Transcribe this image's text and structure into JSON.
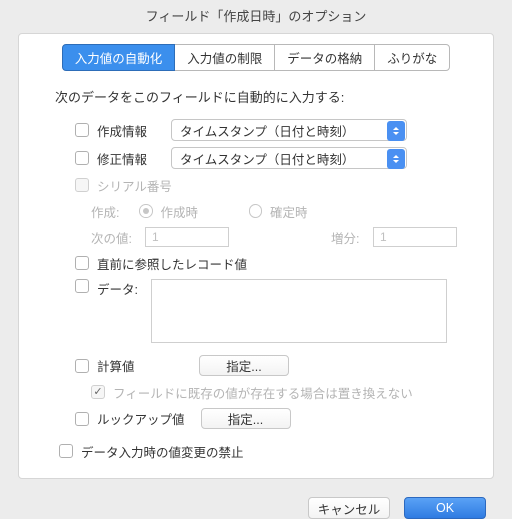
{
  "title": "フィールド「作成日時」のオプション",
  "tabs": [
    "入力値の自動化",
    "入力値の制限",
    "データの格納",
    "ふりがな"
  ],
  "header": "次のデータをこのフィールドに自動的に入力する:",
  "creation": {
    "label": "作成情報",
    "value": "タイムスタンプ（日付と時刻）"
  },
  "modification": {
    "label": "修正情報",
    "value": "タイムスタンプ（日付と時刻）"
  },
  "serial": {
    "label": "シリアル番号",
    "gen_label": "作成:",
    "on_create": "作成時",
    "on_commit": "確定時",
    "next_label": "次の値:",
    "next_value": "1",
    "incr_label": "増分:",
    "incr_value": "1"
  },
  "last_visited": "直前に参照したレコード値",
  "data_label": "データ:",
  "calc": {
    "label": "計算値",
    "button": "指定...",
    "overwrite": "フィールドに既存の値が存在する場合は置き換えない"
  },
  "lookup": {
    "label": "ルックアップ値",
    "button": "指定..."
  },
  "prohibit": "データ入力時の値変更の禁止",
  "footer": {
    "cancel": "キャンセル",
    "ok": "OK"
  }
}
